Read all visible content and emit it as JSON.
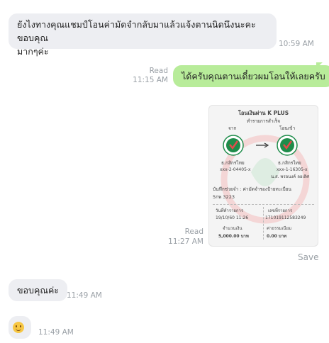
{
  "messages": [
    {
      "id": "m1",
      "side": "in",
      "text_line1": "ยังไงทางคุณแชมป์โอนค่ามัดจำกลับมาแล้วแจ้งตานนิดนึงนะคะ ขอบคุณ",
      "text_line2": "มากๆค่ะ",
      "time": "10:59 AM"
    },
    {
      "id": "m2",
      "side": "out",
      "text": "ได้ครับคุณตานเดี๋ยวผมโอนให้เลยครับ",
      "status": "Read",
      "time": "11:15 AM"
    },
    {
      "id": "m3",
      "side": "out",
      "type": "image",
      "status": "Read",
      "time": "11:27 AM",
      "action": "Save"
    },
    {
      "id": "m4",
      "side": "in",
      "text": "ขอบคุณค่ะ",
      "time": "11:49 AM"
    },
    {
      "id": "m5",
      "side": "in",
      "text": "😊",
      "time": "11:49 AM"
    }
  ],
  "receipt": {
    "title": "โอนเงินผ่าน K PLUS",
    "status": "ทำรายการสำเร็จ",
    "from_label": "จาก",
    "to_label": "โอนเข้า",
    "from_bank": "ธ.กสิกรไทย",
    "from_account": "xxx-2-04405-x",
    "to_bank": "ธ.กสิกรไทย",
    "to_account": "xxx-1-16305-x",
    "to_name": "น.ส. พรอนงค์ ลอเลิศ",
    "memo_label": "บันทึกช่วยจำ : ค่ามัดจำรองป้ายทะเบียน",
    "memo_value": "5กพ 3223",
    "date_label": "วันที่ทำรายการ",
    "date_value": "19/10/60 11:26",
    "ref_label": "เลขที่รายการ",
    "ref_value": "171019112583249",
    "amount_label": "จำนวนเงิน",
    "amount_value": "5,000.00 บาท",
    "fee_label": "ค่าธรรมเนียม",
    "fee_value": "0.00 บาท"
  },
  "colors": {
    "incoming_bubble": "#edeef2",
    "outgoing_bubble": "#b8ec9a",
    "kbank_green": "#1e8c4a",
    "meta_text": "#9aa0a6"
  }
}
